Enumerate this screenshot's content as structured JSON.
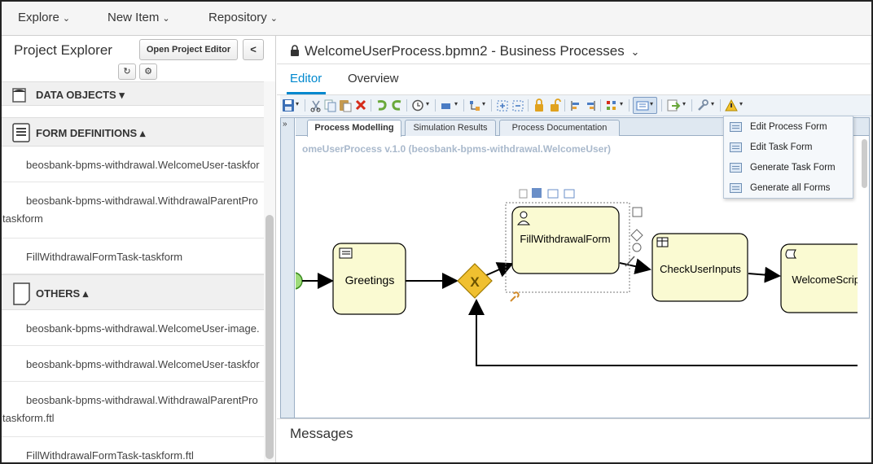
{
  "topnav": {
    "explore": "Explore",
    "new_item": "New Item",
    "repository": "Repository",
    "caret": "⌄"
  },
  "project_explorer": {
    "title": "Project Explorer",
    "open_project_editor": "Open Project Editor",
    "collapse": "<",
    "refresh_icon": "↻",
    "settings_icon": "⚙",
    "sections": [
      {
        "label": "DATA OBJECTS ▾"
      },
      {
        "label": "FORM DEFINITIONS ▴"
      },
      {
        "label": "OTHERS ▴"
      }
    ],
    "form_items": [
      {
        "line1": "beosbank-bpms-withdrawal.WelcomeUser-taskfor",
        "line2": ""
      },
      {
        "line1": "beosbank-bpms-withdrawal.WithdrawalParentPro",
        "line2": "taskform"
      },
      {
        "line1": "FillWithdrawalFormTask-taskform",
        "line2": ""
      }
    ],
    "other_items": [
      {
        "line1": "beosbank-bpms-withdrawal.WelcomeUser-image.",
        "line2": ""
      },
      {
        "line1": "beosbank-bpms-withdrawal.WelcomeUser-taskfor",
        "line2": ""
      },
      {
        "line1": "beosbank-bpms-withdrawal.WithdrawalParentPro",
        "line2": "taskform.ftl"
      },
      {
        "line1": "FillWithdrawalFormTask-taskform.ftl",
        "line2": ""
      }
    ]
  },
  "editor": {
    "title": "WelcomeUserProcess.bpmn2 - Business Processes",
    "title_caret": "⌄",
    "tabs": {
      "editor": "Editor",
      "overview": "Overview"
    },
    "expander": "»",
    "designer_tabs": [
      "Process Modelling",
      "Simulation Results",
      "Process Documentation"
    ],
    "process_label": "omeUserProcess v.1.0 (beosbank-bpms-withdrawal.WelcomeUser)",
    "nodes": {
      "greetings": "Greetings",
      "fill_form": "FillWithdrawalForm",
      "check_inputs": "CheckUserInputs",
      "welcome_script": "WelcomeScript"
    },
    "gateway_symbol": "X",
    "form_menu": [
      "Edit Process Form",
      "Edit Task Form",
      "Generate Task Form",
      "Generate all Forms"
    ],
    "messages_title": "Messages"
  },
  "colors": {
    "accent": "#0088ce",
    "task_fill": "#fafad2",
    "gateway_fill": "#f0c030"
  }
}
